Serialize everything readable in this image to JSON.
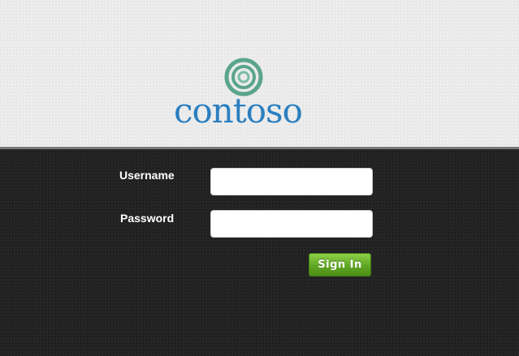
{
  "brand": {
    "name": "contoso",
    "logo_icon": "concentric-rings-logo-icon",
    "text_color": "#2b7fc0",
    "ring_color": "#5aa58c"
  },
  "login": {
    "username_label": "Username",
    "username_value": "",
    "password_label": "Password",
    "password_value": "",
    "signin_label": "Sign In",
    "button_color": "#5fa624"
  },
  "theme": {
    "header_background": "#ebebeb",
    "body_background": "#222222"
  }
}
